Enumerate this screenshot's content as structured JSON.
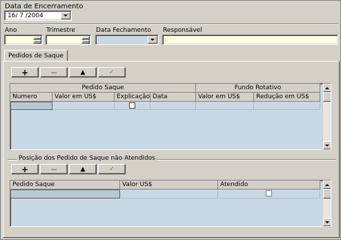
{
  "header": {
    "data_encerramento_label": "Data de Encerramento",
    "data_encerramento_value": "16/ 7 /2004"
  },
  "fields": {
    "ano_label": "Ano",
    "trimestre_label": "Trimestre",
    "data_fechamento_label": "Data Fechamento",
    "responsavel_label": "Responsável",
    "ano_value": "",
    "trimestre_value": "",
    "data_fechamento_value": "",
    "responsavel_value": ""
  },
  "tabs": [
    {
      "label": "Pedidos de Saque"
    }
  ],
  "toolbar1": {
    "add": "+",
    "remove": "−",
    "up": "▲",
    "confirm": "✓"
  },
  "grid1": {
    "group_headers": [
      "Pedido Saque",
      "Fundo Rotativo"
    ],
    "columns": [
      "Numero",
      "Valor em US$",
      "Explicação",
      "Data",
      "Valor em US$",
      "Redução em US$"
    ]
  },
  "section2": {
    "title": "Posição dos Pedido de Saque não Atendidos"
  },
  "toolbar2": {
    "add": "+",
    "remove": "−",
    "up": "▲",
    "confirm": "✓"
  },
  "grid2": {
    "columns": [
      "Pedido Saque",
      "Valor US$",
      "Atendido"
    ]
  },
  "colors": {
    "field_yellow": "#ffffe1",
    "grid_blue": "#c8d8e4",
    "face": "#d4d0c8"
  }
}
